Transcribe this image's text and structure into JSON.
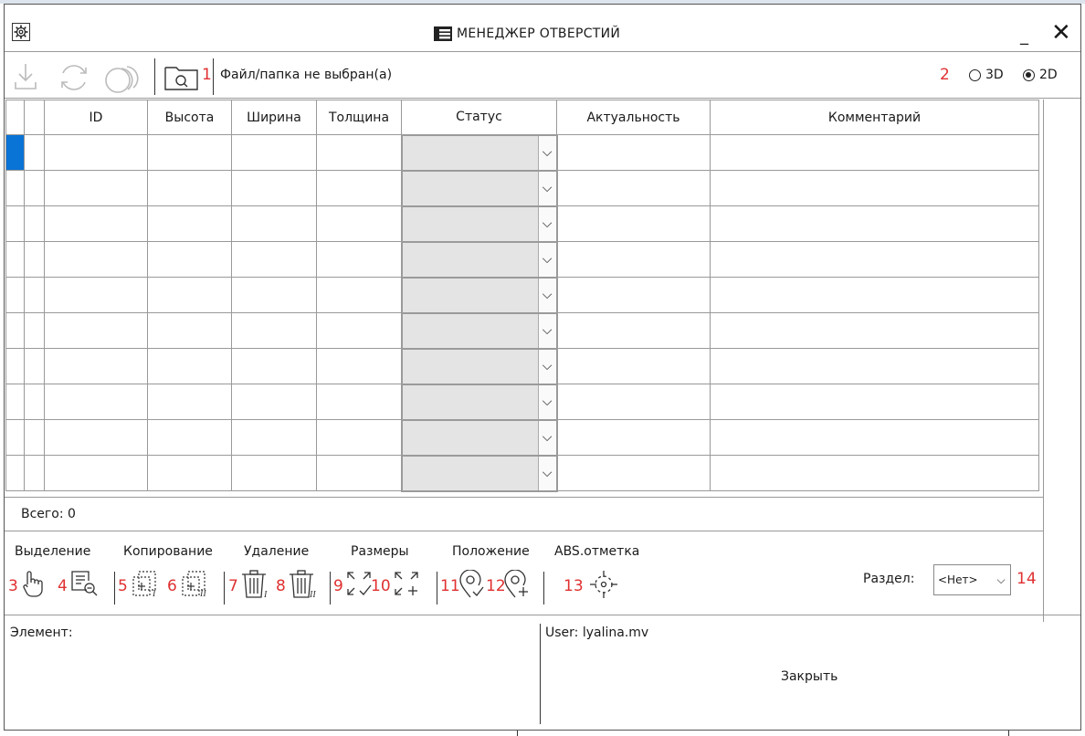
{
  "window": {
    "title": "МЕНЕДЖЕР ОТВЕРСТИЙ",
    "minimize": "_",
    "close": "✕"
  },
  "toolbar": {
    "file_status": "Файл/папка не выбран(а)",
    "marker_file": "1",
    "marker_mode": "2",
    "mode_3d": "3D",
    "mode_2d": "2D",
    "selected_mode": "2D"
  },
  "table": {
    "columns": [
      "ID",
      "Высота",
      "Ширина",
      "Толщина",
      "Статус",
      "Актуальность",
      "Комментарий"
    ],
    "row_count": 10,
    "dropdown_chevron": "⌵"
  },
  "footer": {
    "total_label": "Всего: 0"
  },
  "actions": {
    "groups": [
      "Выделение",
      "Копирование",
      "Удаление",
      "Размеры",
      "Положение",
      "ABS.отметка"
    ],
    "markers": [
      "3",
      "4",
      "5",
      "6",
      "7",
      "8",
      "9",
      "10",
      "11",
      "12",
      "13",
      "14"
    ],
    "section_label": "Раздел:",
    "section_value": "<Нет>",
    "section_chevron": "⌵"
  },
  "bottom": {
    "element_label": "Элемент:",
    "user_label": "User: lyalina.mv",
    "close_button": "Закрыть"
  },
  "colors": {
    "selection": "#0a73d6",
    "markers": "#e03030",
    "status_bg": "#e4e4e4"
  }
}
